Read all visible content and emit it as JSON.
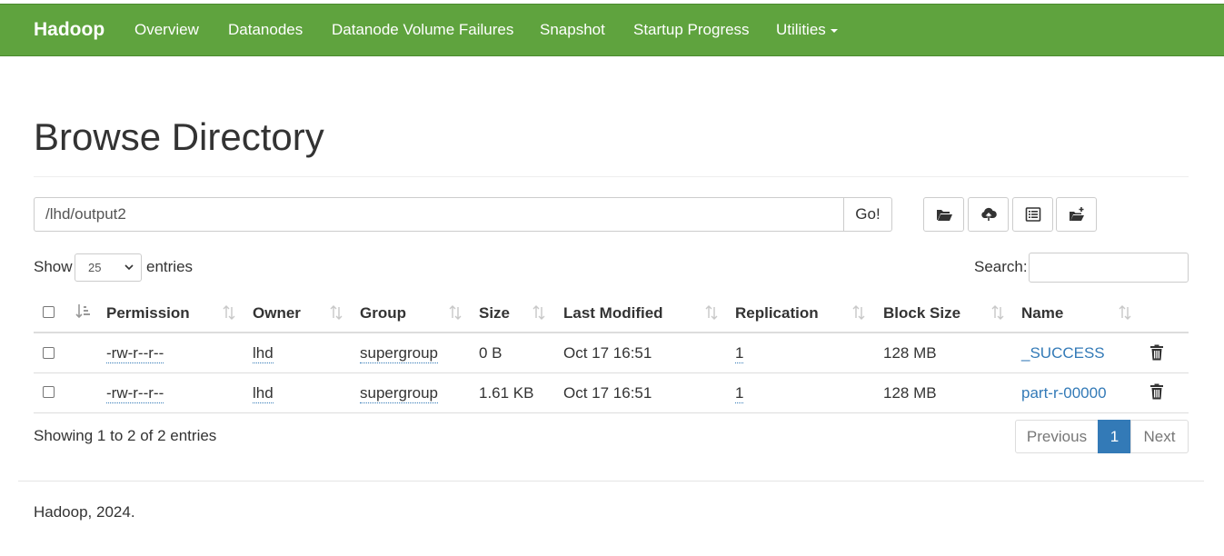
{
  "navbar": {
    "brand": "Hadoop",
    "items": [
      "Overview",
      "Datanodes",
      "Datanode Volume Failures",
      "Snapshot",
      "Startup Progress",
      "Utilities"
    ]
  },
  "page": {
    "title": "Browse Directory"
  },
  "pathbar": {
    "value": "/lhd/output2",
    "go_label": "Go!"
  },
  "toolbar": {
    "icons": [
      "folder-open-icon",
      "cloud-upload-icon",
      "list-alt-icon",
      "folder-new-icon"
    ]
  },
  "controls": {
    "show_label": "Show",
    "entries_value": "25",
    "entries_label": "entries",
    "search_label": "Search:"
  },
  "table": {
    "columns": [
      "Permission",
      "Owner",
      "Group",
      "Size",
      "Last Modified",
      "Replication",
      "Block Size",
      "Name"
    ],
    "rows": [
      {
        "permission": "-rw-r--r--",
        "owner": "lhd",
        "group": "supergroup",
        "size": "0 B",
        "modified": "Oct 17 16:51",
        "replication": "1",
        "block_size": "128 MB",
        "name": "_SUCCESS"
      },
      {
        "permission": "-rw-r--r--",
        "owner": "lhd",
        "group": "supergroup",
        "size": "1.61 KB",
        "modified": "Oct 17 16:51",
        "replication": "1",
        "block_size": "128 MB",
        "name": "part-r-00000"
      }
    ]
  },
  "info": {
    "showing": "Showing 1 to 2 of 2 entries"
  },
  "pagination": {
    "previous": "Previous",
    "current": "1",
    "next": "Next"
  },
  "footer": {
    "text": "Hadoop, 2024."
  },
  "colors": {
    "navbar": "#5fa33e",
    "link": "#337ab7",
    "active_page": "#337ab7"
  }
}
